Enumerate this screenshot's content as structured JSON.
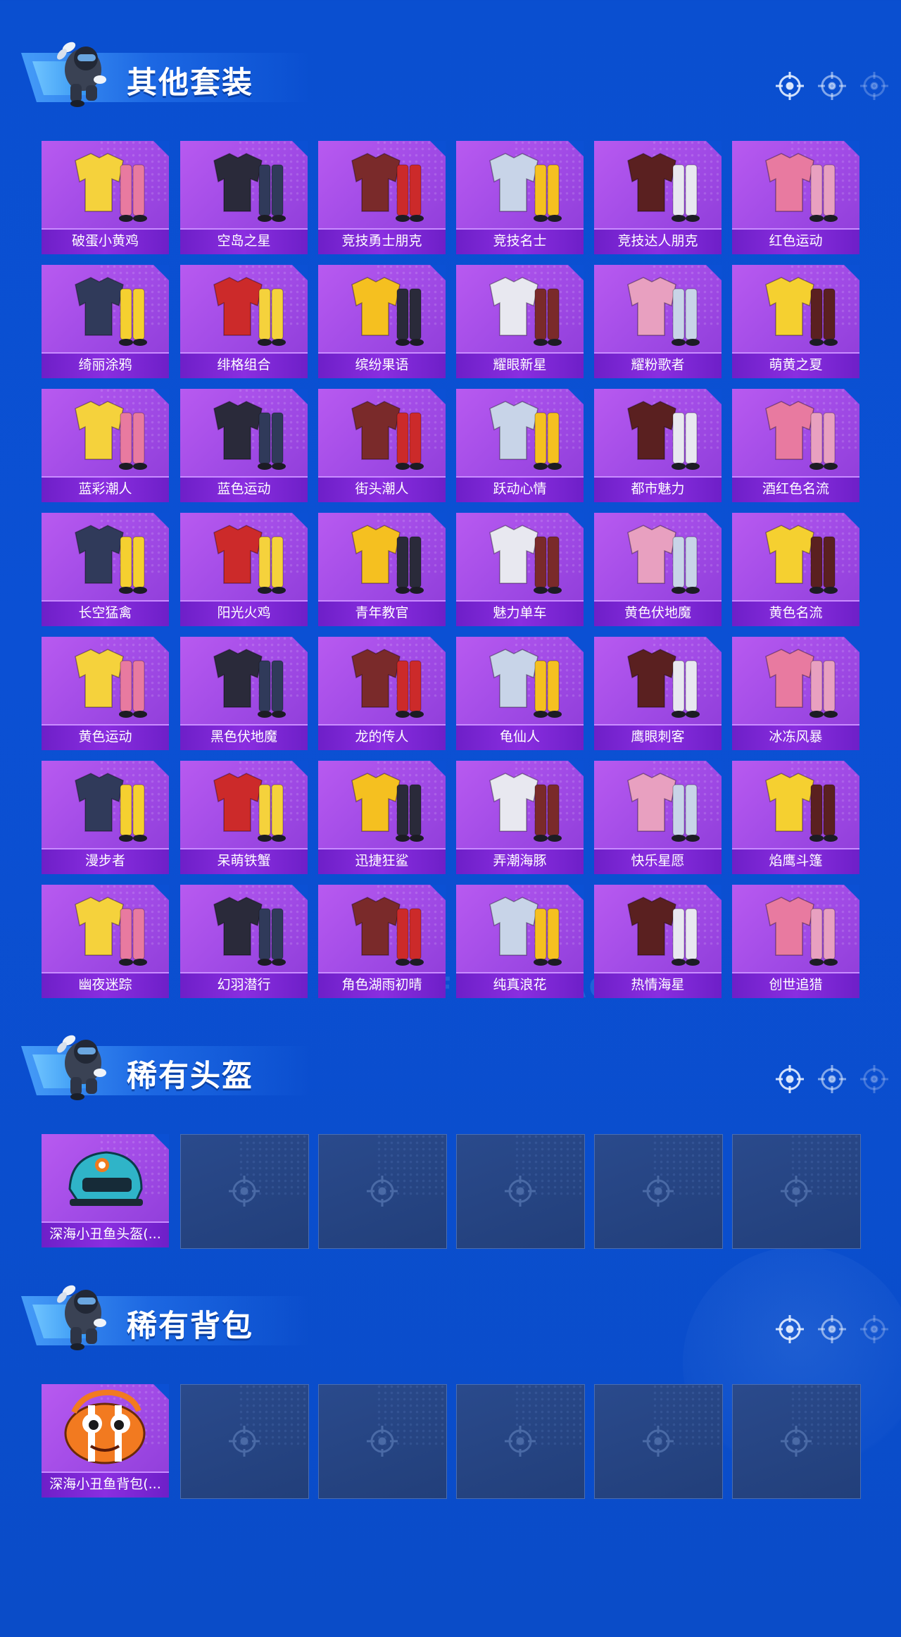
{
  "sections": [
    {
      "title": "其他套装",
      "items": [
        "破蛋小黄鸡",
        "空岛之星",
        "竞技勇士朋克",
        "竞技名士",
        "竞技达人朋克",
        "红色运动",
        "绮丽涂鸦",
        "绯格组合",
        "缤纷果语",
        "耀眼新星",
        "耀粉歌者",
        "萌黄之夏",
        "蓝彩潮人",
        "蓝色运动",
        "街头潮人",
        "跃动心情",
        "都市魅力",
        "酒红色名流",
        "长空猛禽",
        "阳光火鸡",
        "青年教官",
        "魅力单车",
        "黄色伏地魔",
        "黄色名流",
        "黄色运动",
        "黑色伏地魔",
        "龙的传人",
        "龟仙人",
        "鹰眼刺客",
        "冰冻风暴",
        "漫步者",
        "呆萌铁蟹",
        "迅捷狂鲨",
        "弄潮海豚",
        "快乐星愿",
        "焰鹰斗篷",
        "幽夜迷踪",
        "幻羽潜行",
        "角色湖雨初晴",
        "纯真浪花",
        "热情海星",
        "创世追猎"
      ],
      "empty_slots": 0
    },
    {
      "title": "稀有头盔",
      "items": [
        "深海小丑鱼头盔(..."
      ],
      "empty_slots": 5
    },
    {
      "title": "稀有背包",
      "items": [
        "深海小丑鱼背包(..."
      ],
      "empty_slots": 5
    }
  ],
  "background_watermark": "GAME FOR PEACE",
  "colors": {
    "page_bg": "#0b50d4",
    "card_bg": "#a14be6",
    "card_label_bg": "#7a26d4",
    "empty_card_bg": "#243f7c"
  }
}
